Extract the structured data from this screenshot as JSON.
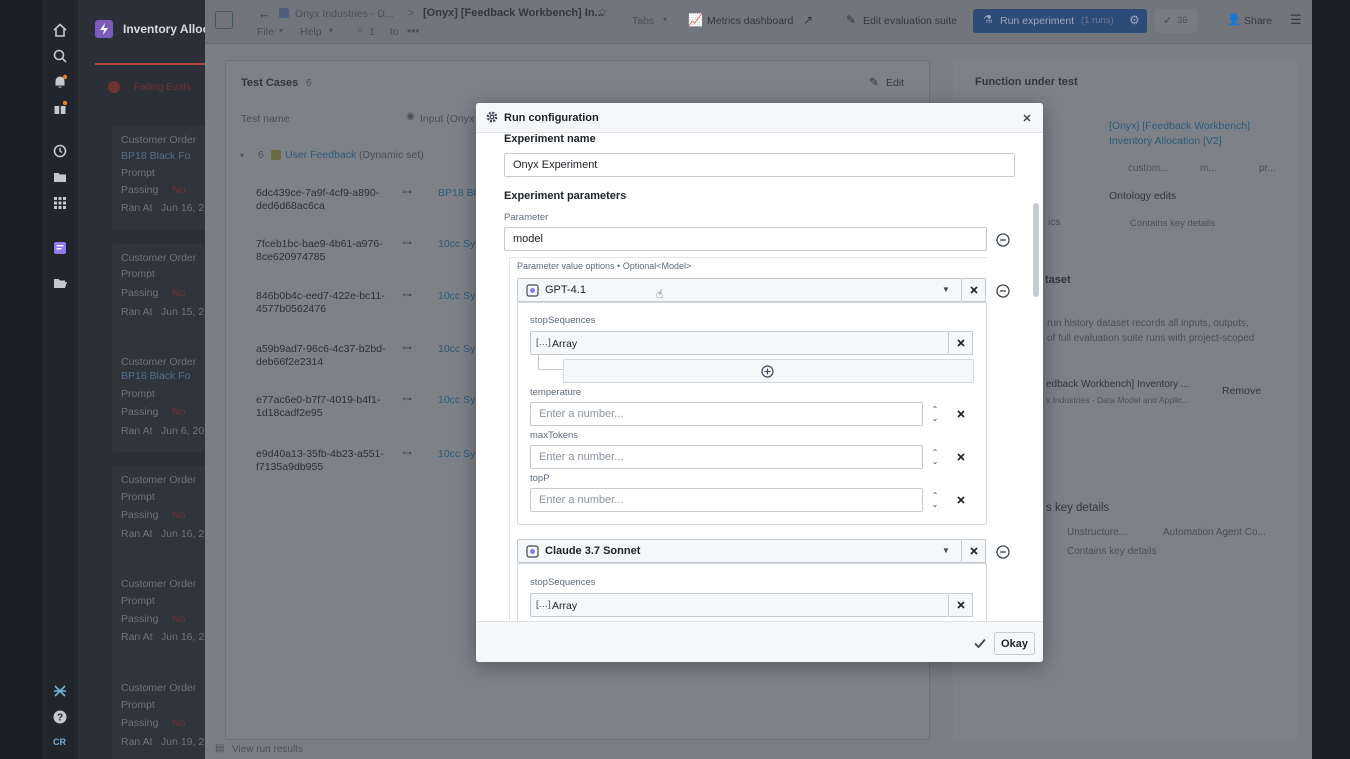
{
  "left_panel": {
    "title": "Inventory Allocat",
    "failing_label": "Failing Evals",
    "cards": [
      {
        "title": "Customer Order",
        "tag": "BP18 Black Fo",
        "prompt": "Prompt",
        "passing": "Passing",
        "passing_val": "No",
        "ran": "Ran At",
        "ran_val": "Jun 16, 2"
      },
      {
        "title": "Customer Order",
        "tag": "",
        "prompt": "Prompt",
        "passing": "Passing",
        "passing_val": "No",
        "ran": "Ran At",
        "ran_val": "Jun 15, 2"
      },
      {
        "title": "Customer Order",
        "tag": "BP18 Black Fo",
        "prompt": "Prompt",
        "passing": "Passing",
        "passing_val": "No",
        "ran": "Ran At",
        "ran_val": "Jun 6, 20"
      },
      {
        "title": "Customer Order",
        "tag": "",
        "prompt": "Prompt",
        "passing": "Passing",
        "passing_val": "No",
        "ran": "Ran At",
        "ran_val": "Jun 16, 2"
      },
      {
        "title": "Customer Order",
        "tag": "",
        "prompt": "Prompt",
        "passing": "Passing",
        "passing_val": "No",
        "ran": "Ran At",
        "ran_val": "Jun 16, 2"
      },
      {
        "title": "Customer Order",
        "tag": "",
        "prompt": "Prompt",
        "passing": "Passing",
        "passing_val": "No",
        "ran": "Ran At",
        "ran_val": "Jun 19, 2"
      }
    ],
    "user_initials": "CR"
  },
  "header": {
    "breadcrumb_org": "Onyx Industries - D...",
    "breadcrumb_sep": ">",
    "breadcrumb_page": "[Onyx] [Feedback Workbench] In...",
    "menu_file": "File",
    "menu_help": "Help",
    "count_one": "1",
    "to_label": "to",
    "tabs_label": "Tabs",
    "metrics_label": "Metrics dashboard",
    "edit_suite_label": "Edit evaluation suite",
    "run_label": "Run experiment",
    "run_count": "(1 runs)",
    "check_count": "36",
    "share_label": "Share"
  },
  "test_cases": {
    "title": "Test Cases",
    "count": "6",
    "edit_label": "Edit",
    "col_name": "Test name",
    "col_input": "Input (Onyx",
    "group_count": "6",
    "group_label": "User Feedback",
    "group_type": "(Dynamic set)",
    "rows": [
      {
        "id1": "6dc439ce-7a9f-4cf9-a890-",
        "id2": "ded6d68ac6ca",
        "input": "BP18 Bl"
      },
      {
        "id1": "7fceb1bc-bae9-4b61-a976-",
        "id2": "8ce620974785",
        "input": "10cc Sy"
      },
      {
        "id1": "846b0b4c-eed7-422e-bc11-",
        "id2": "4577b0562476",
        "input": "10cc Sy"
      },
      {
        "id1": "a59b9ad7-96c6-4c37-b2bd-",
        "id2": "deb66f2e2314",
        "input": "10cc Sy"
      },
      {
        "id1": "e77ac6e0-b7f7-4019-b4f1-",
        "id2": "1d18cadf2e95",
        "input": "10cc Sy"
      },
      {
        "id1": "e9d40a13-35fb-4b23-a551-",
        "id2": "f7135a9db955",
        "input": "10cc Sy"
      }
    ],
    "footer": "View run results"
  },
  "right_col": {
    "title": "Function under test",
    "func_name": "[Onyx] [Feedback Workbench]",
    "func_name2": "Inventory Allocation [V2]",
    "chip1": "custom...",
    "chip2": "m...",
    "chip3": "pr...",
    "ontology_edits": "Ontology edits",
    "ics": "ics",
    "contains_key": "Contains key details",
    "dataset_title": "taset",
    "dataset_desc1": "run history dataset records all inputs, outputs,",
    "dataset_desc2": "of full evaluation suite runs with project-scoped",
    "dataset_item": "edback Workbench] Inventory ...",
    "dataset_item_sub": "x Industries - Data Model and Applic...",
    "remove_label": "Remove",
    "key_details_title": "s key details",
    "kd1": "Unstructure...",
    "kd2": "Automation Agent Co...",
    "kd3": "Contains key details"
  },
  "modal": {
    "title": "Run configuration",
    "experiment_name_label": "Experiment name",
    "experiment_name_value": "Onyx Experiment",
    "params_label": "Experiment parameters",
    "param_label": "Parameter",
    "param_value": "model",
    "options_label": "Parameter value options • Optional<Model>",
    "model1": "GPT-4.1",
    "model2": "Claude 3.7 Sonnet",
    "stop_label": "stopSequences",
    "array_label": "Array",
    "temperature_label": "temperature",
    "maxtokens_label": "maxTokens",
    "topp_label": "topP",
    "number_placeholder": "Enter a number...",
    "okay_label": "Okay"
  }
}
